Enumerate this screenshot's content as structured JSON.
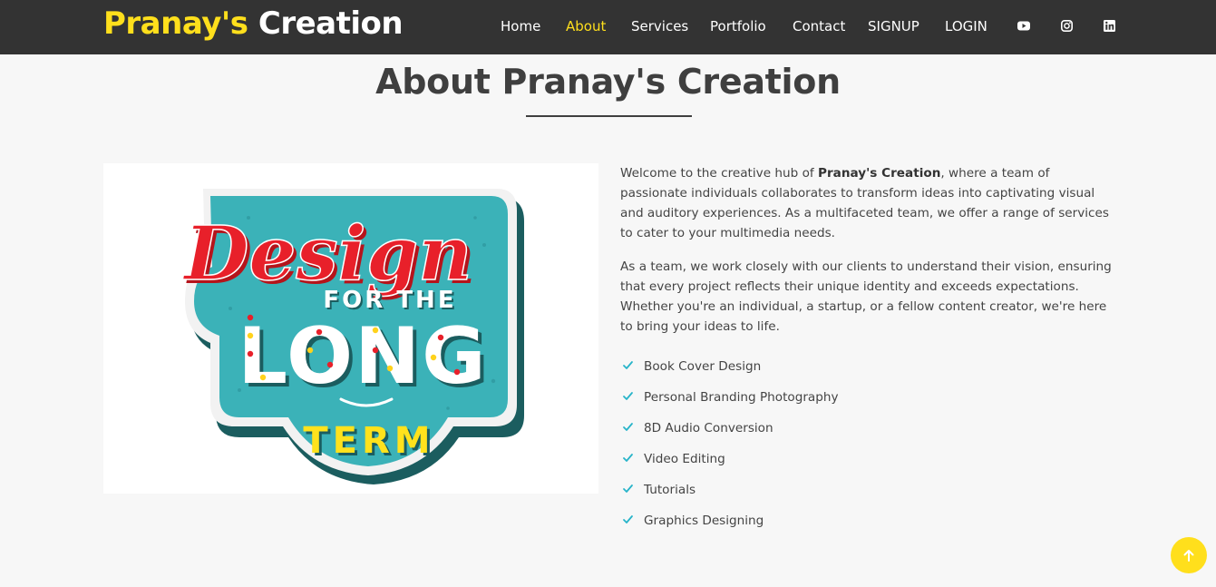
{
  "header": {
    "logo_part1": "Pranay's",
    "logo_part2": "Creation",
    "nav": [
      {
        "label": "Home"
      },
      {
        "label": "About"
      },
      {
        "label": "Services"
      },
      {
        "label": "Portfolio"
      },
      {
        "label": "Contact"
      },
      {
        "label": "SIGNUP"
      },
      {
        "label": "LOGIN"
      }
    ],
    "active_nav": "About",
    "social_icons": [
      "youtube-icon",
      "instagram-icon",
      "linkedin-icon"
    ]
  },
  "about": {
    "title": "About Pranay's Creation",
    "image": {
      "line1": "Design",
      "line2": "FOR THE",
      "line3": "LONG",
      "line4": "TERM"
    },
    "p1_before": "Welcome to the creative hub of ",
    "p1_bold": "Pranay's Creation",
    "p1_after": ", where a team of passionate individuals collaborates to transform ideas into captivating visual and auditory experiences. As a multifaceted team, we offer a range of services to cater to your multimedia needs.",
    "p2": "As a team, we work closely with our clients to understand their vision, ensuring that every project reflects their unique identity and exceeds expectations. Whether you're an individual, a startup, or a fellow content creator, we're here to bring your ideas to life.",
    "features": [
      "Book Cover Design",
      "Personal Branding Photography",
      "8D Audio Conversion",
      "Video Editing",
      "Tutorials",
      "Graphics Designing"
    ]
  },
  "colors": {
    "header_bg": "#333333",
    "accent_yellow": "#ffdf1c",
    "check_teal": "#27b4c9",
    "page_bg": "#f7f7f7",
    "badge_teal": "#3bb2b8",
    "badge_red": "#e8202a"
  },
  "back_to_top_icon": "arrow-up-icon"
}
